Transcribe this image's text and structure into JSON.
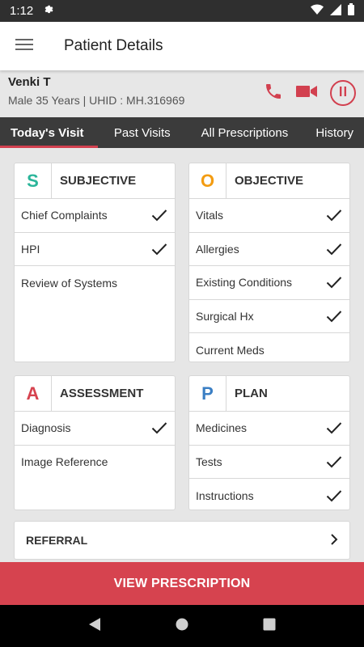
{
  "status_bar": {
    "time": "1:12"
  },
  "app_bar": {
    "title": "Patient Details"
  },
  "patient": {
    "name": "Venki T",
    "meta": "Male 35 Years |   UHID : MH.316969"
  },
  "tabs": [
    {
      "label": "Today's Visit",
      "active": true
    },
    {
      "label": "Past Visits",
      "active": false
    },
    {
      "label": "All Prescriptions",
      "active": false
    },
    {
      "label": "History",
      "active": false
    }
  ],
  "cards": {
    "subjective": {
      "letter": "S",
      "label": "SUBJECTIVE",
      "color": "#2bb59a",
      "items": [
        {
          "label": "Chief Complaints",
          "checked": true
        },
        {
          "label": "HPI",
          "checked": true
        },
        {
          "label": "Review of Systems",
          "checked": false
        }
      ]
    },
    "objective": {
      "letter": "O",
      "label": "OBJECTIVE",
      "color": "#f39c12",
      "items": [
        {
          "label": "Vitals",
          "checked": true
        },
        {
          "label": "Allergies",
          "checked": true
        },
        {
          "label": "Existing Conditions",
          "checked": true
        },
        {
          "label": "Surgical Hx",
          "checked": true
        },
        {
          "label": "Current Meds",
          "checked": false
        }
      ]
    },
    "assessment": {
      "letter": "A",
      "label": "ASSESSMENT",
      "color": "#d6434f",
      "items": [
        {
          "label": "Diagnosis",
          "checked": true
        },
        {
          "label": "Image Reference",
          "checked": false
        }
      ]
    },
    "plan": {
      "letter": "P",
      "label": "PLAN",
      "color": "#3b7fc4",
      "items": [
        {
          "label": "Medicines",
          "checked": true
        },
        {
          "label": "Tests",
          "checked": true
        },
        {
          "label": "Instructions",
          "checked": true
        }
      ]
    }
  },
  "referral": {
    "label": "REFERRAL"
  },
  "footer": {
    "view_prescription": "VIEW PRESCRIPTION"
  },
  "colors": {
    "accent": "#d6434f",
    "tab_bg": "#3b3b3b"
  }
}
